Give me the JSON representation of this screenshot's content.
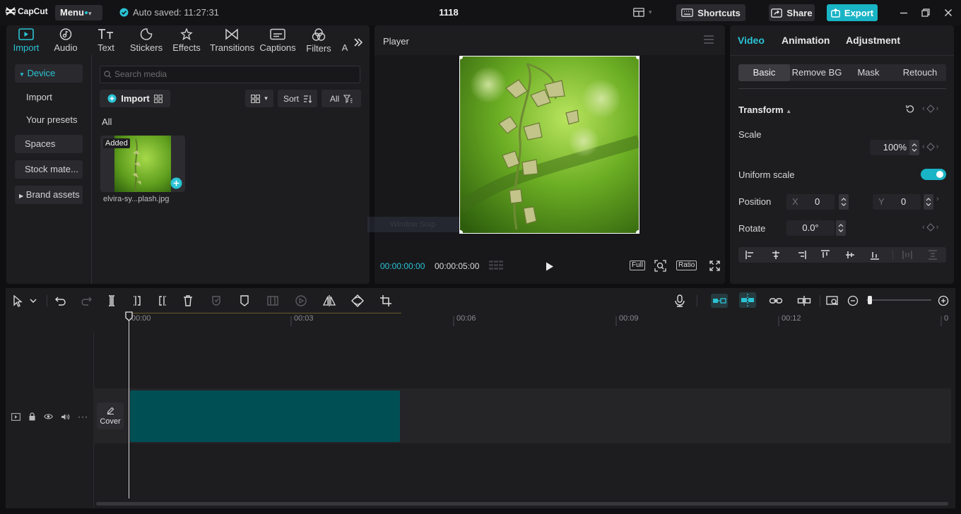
{
  "app": {
    "logo_text": "CapCut",
    "menu_label": "Menu",
    "autosave_text": "Auto saved: 11:27:31",
    "project_title": "1118",
    "shortcuts_label": "Shortcuts",
    "share_label": "Share",
    "export_label": "Export"
  },
  "media": {
    "tabs": [
      {
        "label": "Import",
        "icon": "import-icon",
        "active": true
      },
      {
        "label": "Audio",
        "icon": "audio-icon"
      },
      {
        "label": "Text",
        "icon": "text-icon"
      },
      {
        "label": "Stickers",
        "icon": "stickers-icon"
      },
      {
        "label": "Effects",
        "icon": "effects-icon"
      },
      {
        "label": "Transitions",
        "icon": "transitions-icon"
      },
      {
        "label": "Captions",
        "icon": "captions-icon"
      },
      {
        "label": "Filters",
        "icon": "filters-icon"
      },
      {
        "label": "A",
        "icon": "more-tab-icon"
      }
    ],
    "sidebar": [
      {
        "label": "Device",
        "active": true
      },
      {
        "label": "Import"
      },
      {
        "label": "Your presets"
      },
      {
        "label": "Spaces"
      },
      {
        "label": "Stock mate..."
      },
      {
        "label": "Brand assets"
      }
    ],
    "search_placeholder": "Search media",
    "import_label": "Import",
    "sort_label": "Sort",
    "filter_all_label": "All",
    "section_label": "All",
    "items": [
      {
        "filename": "elvira-sy...plash.jpg",
        "badge": "Added"
      }
    ]
  },
  "player": {
    "title": "Player",
    "current_time": "00:00:00:00",
    "total_time": "00:00:05:00",
    "full_label": "Full",
    "ratio_label": "Ratio",
    "watermark_text": "Window Snip"
  },
  "properties": {
    "tabs": [
      {
        "label": "Video",
        "active": true
      },
      {
        "label": "Animation"
      },
      {
        "label": "Adjustment"
      }
    ],
    "subtabs": [
      {
        "label": "Basic",
        "active": true
      },
      {
        "label": "Remove BG"
      },
      {
        "label": "Mask"
      },
      {
        "label": "Retouch"
      }
    ],
    "transform_title": "Transform",
    "scale_label": "Scale",
    "scale_value": "100%",
    "uniform_scale_label": "Uniform scale",
    "uniform_scale_on": true,
    "position_label": "Position",
    "pos_x_label": "X",
    "pos_x_value": "0",
    "pos_y_label": "Y",
    "pos_y_value": "0",
    "rotate_label": "Rotate",
    "rotate_value": "0.0°"
  },
  "timeline": {
    "ruler": [
      "00:00",
      "00:03",
      "00:06",
      "00:09",
      "00:12"
    ],
    "cover_label": "Cover"
  },
  "colors": {
    "accent": "#2ac3d4",
    "clip": "#004f55",
    "panel": "#1d1d20",
    "background": "#0f0f11"
  }
}
